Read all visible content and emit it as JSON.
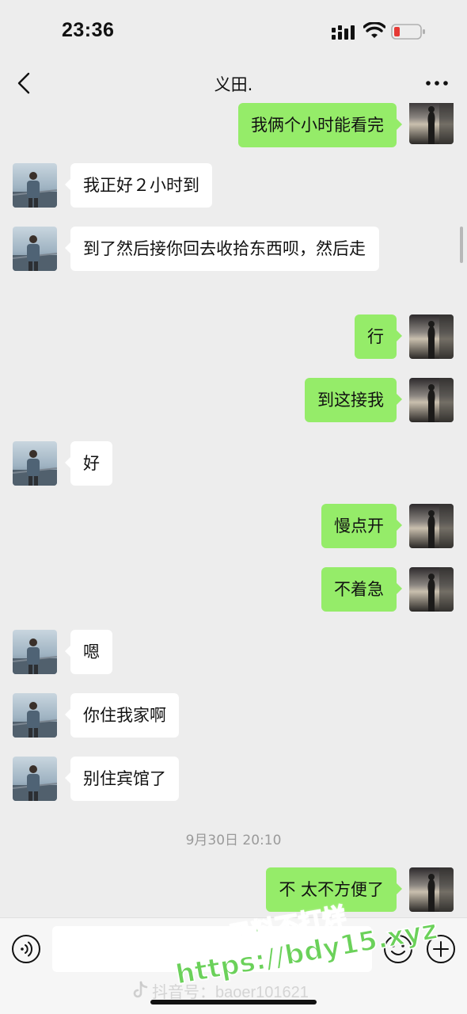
{
  "status_bar": {
    "time": "23:36",
    "icons": [
      "signal-icon",
      "wifi-icon",
      "battery-icon"
    ],
    "battery_color": "#e53935"
  },
  "nav": {
    "title": "义田.",
    "icons": [
      "back-icon",
      "more-icon"
    ]
  },
  "messages": [
    {
      "side": "right",
      "text": "我俩个小时能看完"
    },
    {
      "side": "left",
      "text": "我正好２小时到"
    },
    {
      "side": "left",
      "text": "到了然后接你回去收拾东西呗，然后走"
    },
    {
      "side": "right",
      "text": "行"
    },
    {
      "side": "right",
      "text": "到这接我"
    },
    {
      "side": "left",
      "text": "好"
    },
    {
      "side": "right",
      "text": "慢点开"
    },
    {
      "side": "right",
      "text": "不着急"
    },
    {
      "side": "left",
      "text": "嗯"
    },
    {
      "side": "left",
      "text": "你住我家啊"
    },
    {
      "side": "left",
      "text": "别住宾馆了"
    },
    {
      "side": "right",
      "text": "不 太不方便了"
    }
  ],
  "timestamp": "9月30日 20:10",
  "input_bar": {
    "value": "",
    "icons": [
      "voice-icon",
      "emoji-icon",
      "plus-icon"
    ]
  },
  "overlay": {
    "douyin_id": "抖音号：baoer101621",
    "watermark_line1": "黑料不打烊",
    "watermark_line2": "https://bdy15.xyz"
  },
  "colors": {
    "background": "#ededed",
    "bubble_sent": "#95ec69",
    "bubble_received": "#ffffff",
    "watermark": "#6bd15a"
  }
}
